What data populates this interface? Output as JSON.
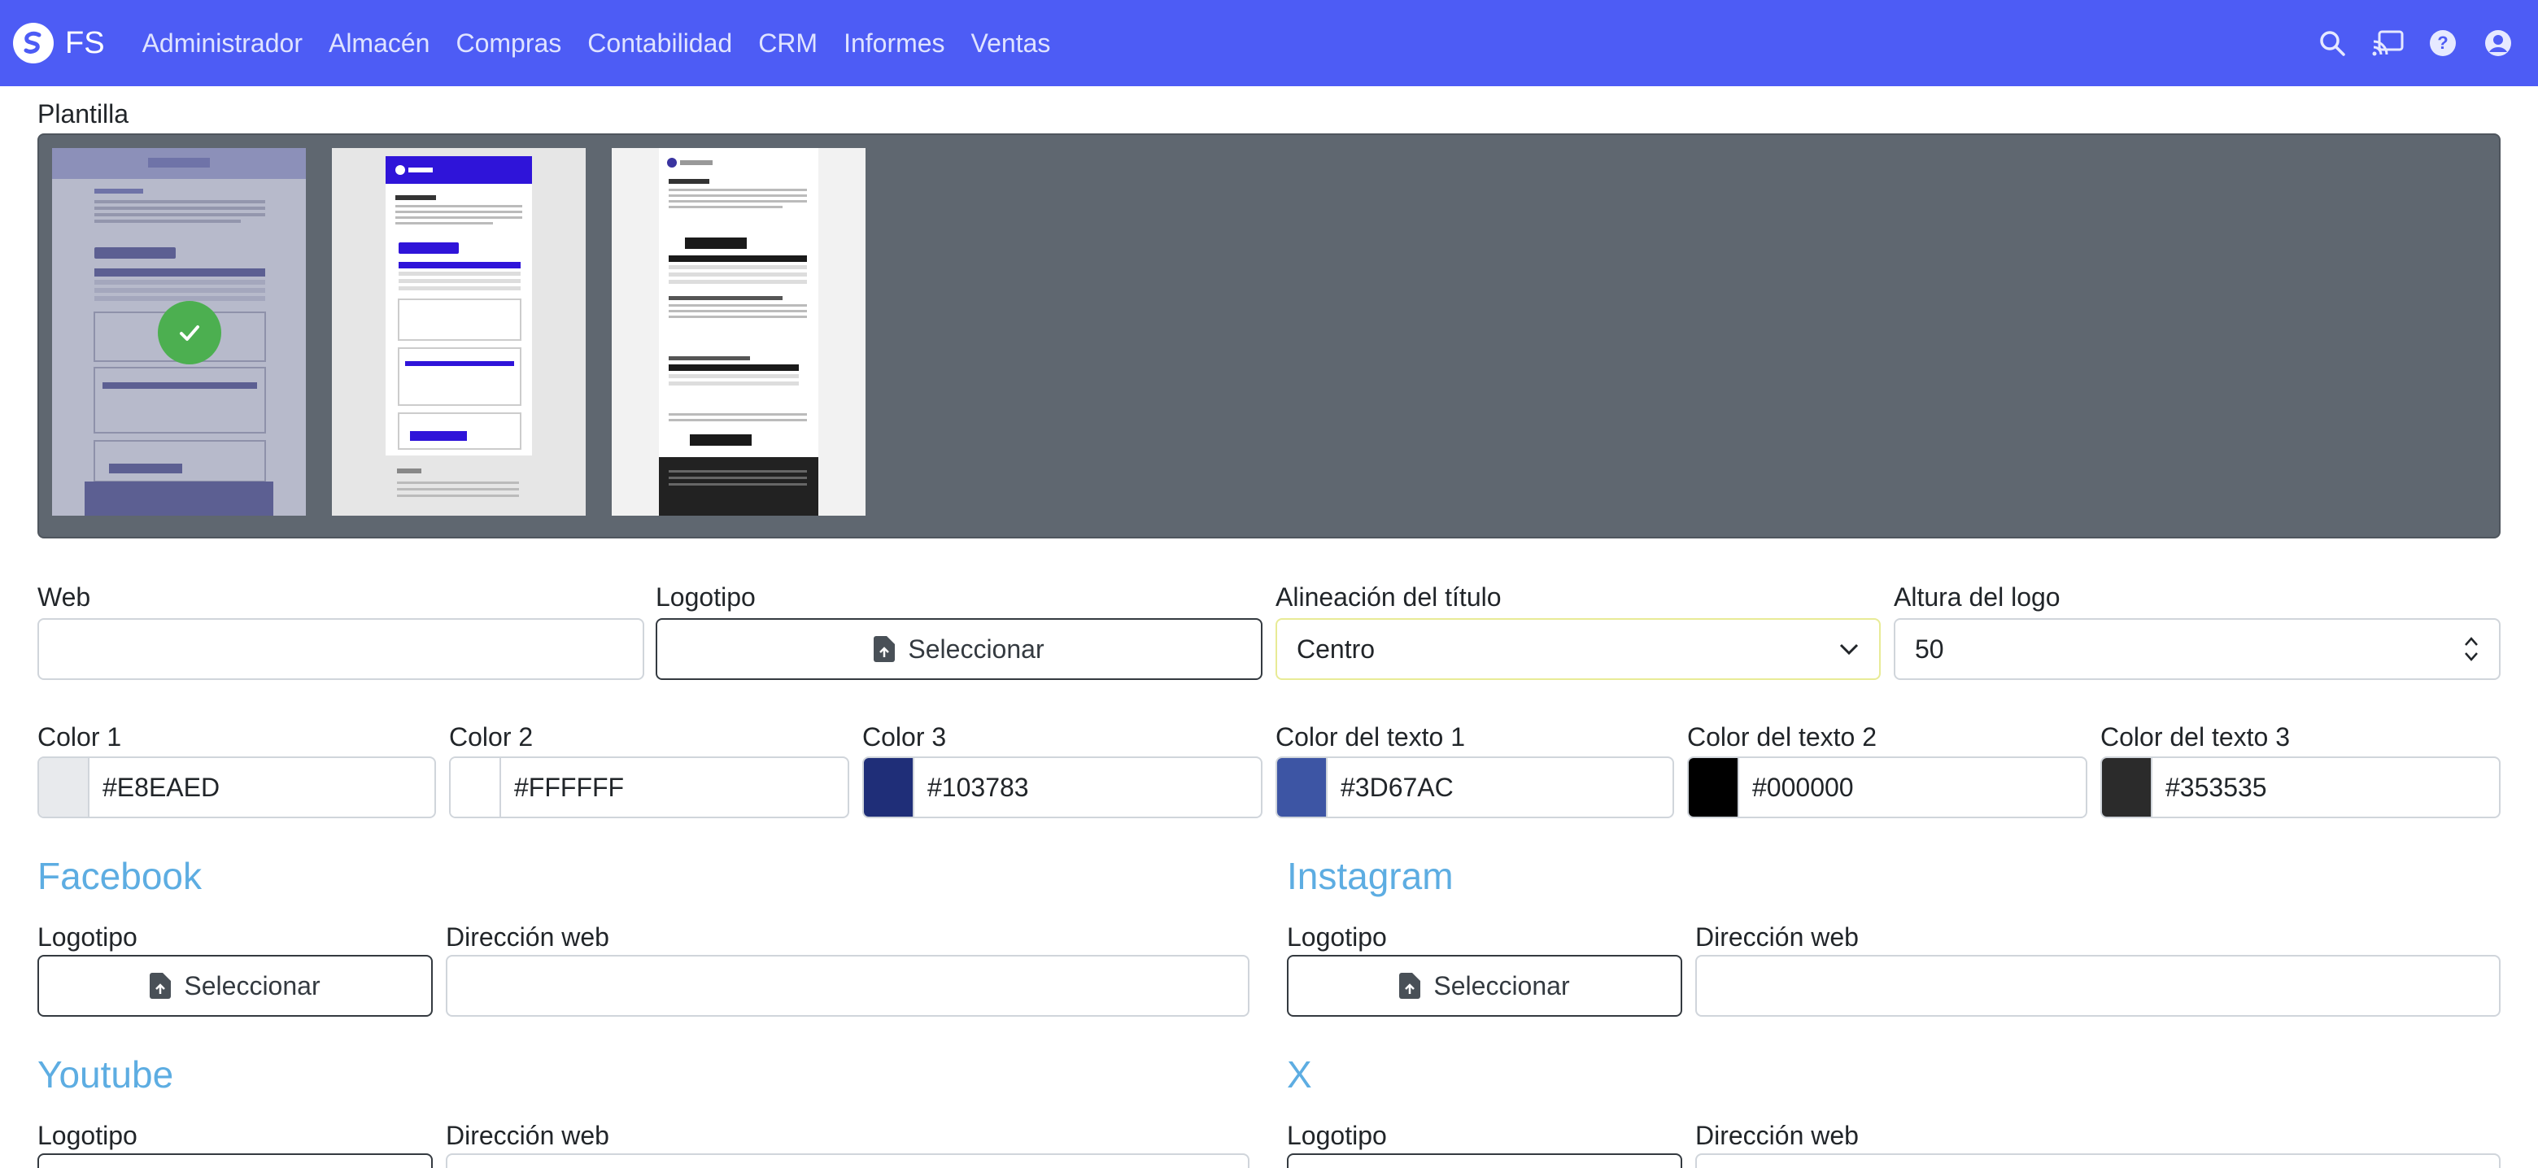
{
  "navbar": {
    "brand": "FS",
    "items": [
      "Administrador",
      "Almacén",
      "Compras",
      "Contabilidad",
      "CRM",
      "Informes",
      "Ventas"
    ],
    "icons": [
      "search-icon",
      "cast-icon",
      "help-icon",
      "user-icon"
    ],
    "background": "#4D5CF5"
  },
  "template": {
    "label": "Plantilla",
    "thumbnails": [
      "template-1",
      "template-2",
      "template-3"
    ],
    "selected_index": 0
  },
  "form": {
    "web": {
      "label": "Web",
      "value": ""
    },
    "logo": {
      "label": "Logotipo",
      "button": "Seleccionar"
    },
    "title_alignment": {
      "label": "Alineación del título",
      "value": "Centro"
    },
    "logo_height": {
      "label": "Altura del logo",
      "value": "50"
    }
  },
  "colors": [
    {
      "label": "Color 1",
      "value": "#E8EAED",
      "swatch": "#E8EAED"
    },
    {
      "label": "Color 2",
      "value": "#FFFFFF",
      "swatch": "#FFFFFF"
    },
    {
      "label": "Color 3",
      "value": "#103783",
      "swatch": "#1F2E78"
    },
    {
      "label": "Color del texto 1",
      "value": "#3D67AC",
      "swatch": "#3D55A4"
    },
    {
      "label": "Color del texto 2",
      "value": "#000000",
      "swatch": "#000000"
    },
    {
      "label": "Color del texto 3",
      "value": "#353535",
      "swatch": "#2B2B2B"
    }
  ],
  "social": {
    "facebook": {
      "title": "Facebook",
      "logo_label": "Logotipo",
      "button": "Seleccionar",
      "url_label": "Dirección web",
      "url": ""
    },
    "instagram": {
      "title": "Instagram",
      "logo_label": "Logotipo",
      "button": "Seleccionar",
      "url_label": "Dirección web",
      "url": ""
    },
    "youtube": {
      "title": "Youtube",
      "logo_label": "Logotipo",
      "url_label": "Dirección web"
    },
    "x": {
      "title": "X",
      "logo_label": "Logotipo",
      "url_label": "Dirección web"
    }
  },
  "accent_color": "#5DADE2"
}
